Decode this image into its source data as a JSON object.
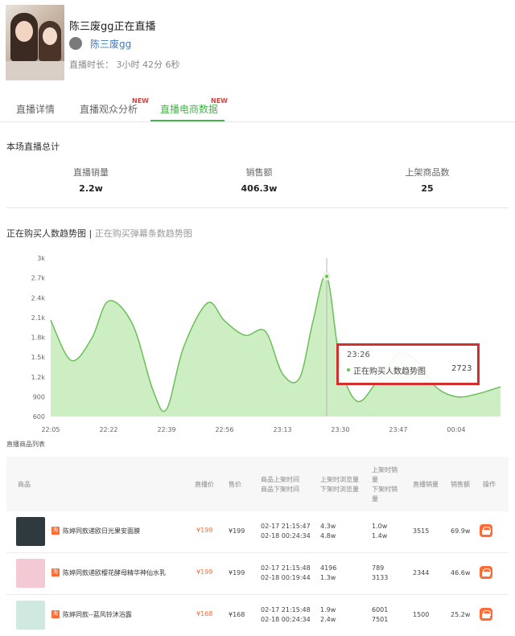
{
  "stream": {
    "title": "陈三废gg正在直播",
    "username": "陈三废gg",
    "duration": "直播时长： 3小时 42分 6秒"
  },
  "tabs": [
    {
      "label": "直播详情",
      "new": ""
    },
    {
      "label": "直播观众分析",
      "new": "NEW"
    },
    {
      "label": "直播电商数据",
      "new": "NEW"
    }
  ],
  "summary": {
    "title": "本场直播总计",
    "stats": [
      {
        "label": "直播销量",
        "value": "2.2w"
      },
      {
        "label": "销售额",
        "value": "406.3w"
      },
      {
        "label": "上架商品数",
        "value": "25"
      }
    ]
  },
  "chart_links": {
    "active": "正在购买人数趋势图",
    "separator": "|",
    "inactive": "正在购买弹幕条数趋势图"
  },
  "chart_data": {
    "type": "area",
    "title": "",
    "xlabel": "",
    "ylabel": "",
    "ylim": [
      600,
      3000
    ],
    "grid": false,
    "x_ticks": [
      "22:05",
      "22:22",
      "22:39",
      "22:56",
      "23:13",
      "23:30",
      "23:47",
      "00:04"
    ],
    "y_ticks": [
      "600",
      "900",
      "1.2k",
      "1.5k",
      "1.8k",
      "2.1k",
      "2.4k",
      "2.7k",
      "3k"
    ],
    "x": [
      "22:05",
      "22:11",
      "22:17",
      "22:22",
      "22:29",
      "22:35",
      "22:39",
      "22:44",
      "22:51",
      "22:56",
      "23:02",
      "23:08",
      "23:13",
      "23:18",
      "23:22",
      "23:26",
      "23:30",
      "23:35",
      "23:41",
      "23:47",
      "23:53",
      "23:58",
      "00:04",
      "00:10",
      "00:17"
    ],
    "series": [
      {
        "name": "正在购买人数趋势图",
        "color": "#6bbf59",
        "values": [
          2060,
          1450,
          1780,
          2350,
          2000,
          1000,
          710,
          1650,
          2320,
          2050,
          1830,
          1890,
          1250,
          1180,
          2050,
          2723,
          1400,
          830,
          1150,
          1550,
          1420,
          1050,
          900,
          940,
          1050
        ]
      }
    ],
    "tooltip": {
      "time": "23:26",
      "label": "正在购买人数趋势图",
      "value": "2723"
    }
  },
  "products": {
    "title": "直播商品列表",
    "headers": {
      "product": "商品",
      "live_price": "直播价",
      "price": "售价",
      "time": [
        "商品上架时间",
        "商品下架时间"
      ],
      "views": [
        "上架时浏览量",
        "下架时浏览量"
      ],
      "sales_shelf": [
        "上架时销",
        "量",
        "下架时销",
        "量"
      ],
      "live_sales": "直播销量",
      "revenue": "销售额",
      "action": "操作"
    },
    "rows": [
      {
        "tag": "淘",
        "name": "陈婷同款递欧日光果安面膜",
        "live_price": "¥199",
        "price": "¥199",
        "time_on": "02-17 21:15:47",
        "time_off": "02-18 00:24:34",
        "views_on": "4.3w",
        "views_off": "4.8w",
        "sales_on": "1.0w",
        "sales_off": "1.4w",
        "live_sales": "3515",
        "revenue": "69.9w",
        "img_color": "#2f3a3f"
      },
      {
        "tag": "淘",
        "name": "陈婷同款递欧樱花酵母精华神仙水乳",
        "live_price": "¥199",
        "price": "¥199",
        "time_on": "02-17 21:15:48",
        "time_off": "02-18 00:19:44",
        "views_on": "4196",
        "views_off": "1.3w",
        "sales_on": "789",
        "sales_off": "3133",
        "live_sales": "2344",
        "revenue": "46.6w",
        "img_color": "#f3c9d3"
      },
      {
        "tag": "淘",
        "name": "陈婷同款--蓝风铃沐浴露",
        "live_price": "¥168",
        "price": "¥168",
        "time_on": "02-17 21:15:48",
        "time_off": "02-18 00:24:34",
        "views_on": "1.9w",
        "views_off": "2.4w",
        "sales_on": "6001",
        "sales_off": "7501",
        "live_sales": "1500",
        "revenue": "25.2w",
        "img_color": "#cfe9e1"
      }
    ]
  }
}
